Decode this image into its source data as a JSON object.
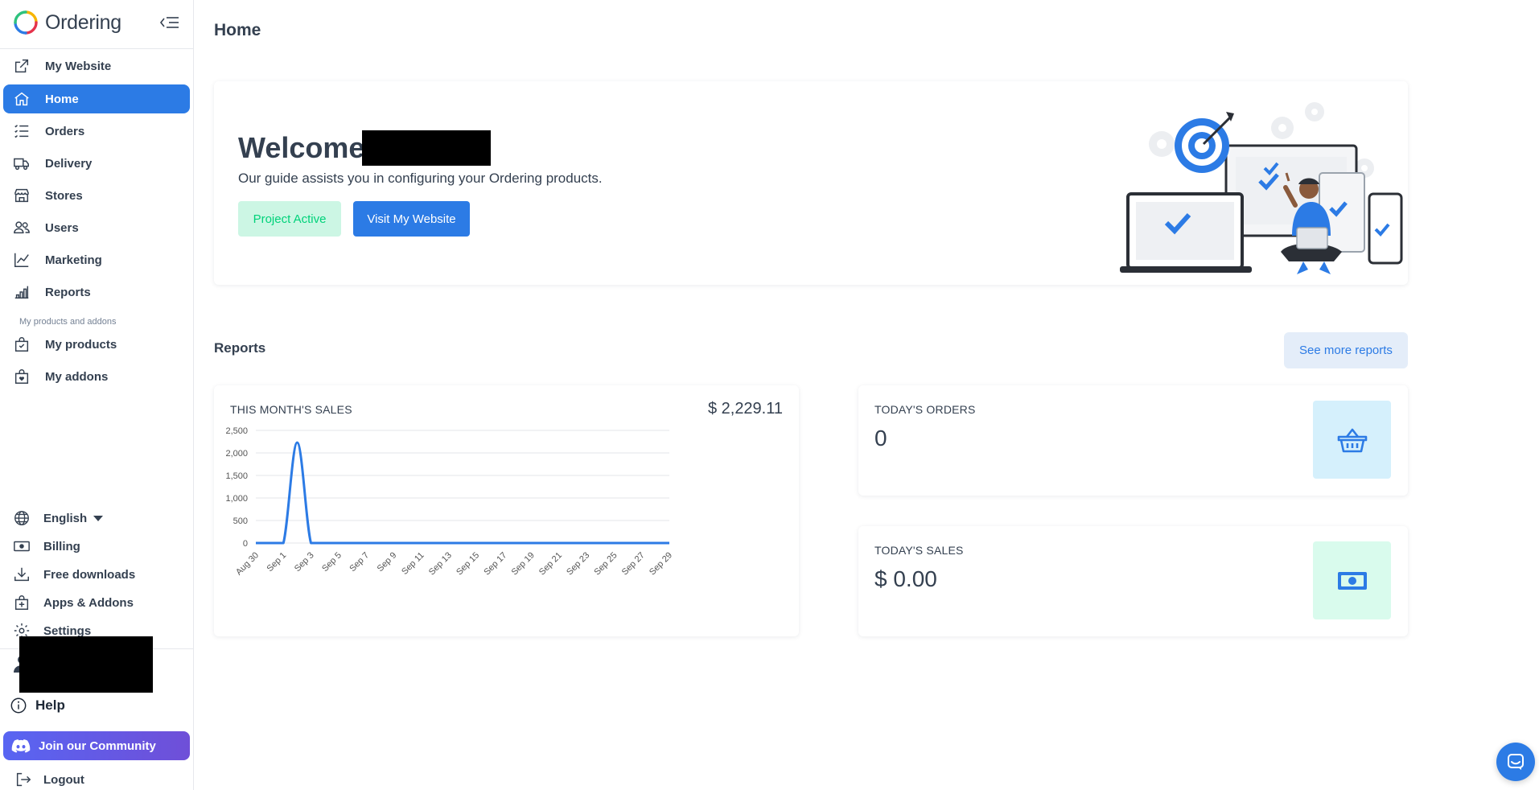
{
  "brand": {
    "name": "Ordering"
  },
  "sidebar": {
    "nav": [
      {
        "label": "My Website",
        "icon": "external-link-icon",
        "active": false
      },
      {
        "label": "Home",
        "icon": "house-icon",
        "active": true
      },
      {
        "label": "Orders",
        "icon": "list-icon",
        "active": false
      },
      {
        "label": "Delivery",
        "icon": "truck-icon",
        "active": false
      },
      {
        "label": "Stores",
        "icon": "shop-icon",
        "active": false
      },
      {
        "label": "Users",
        "icon": "people-icon",
        "active": false
      },
      {
        "label": "Marketing",
        "icon": "graph-up-icon",
        "active": false
      },
      {
        "label": "Reports",
        "icon": "bar-chart-icon",
        "active": false
      }
    ],
    "section_label": "My products and addons",
    "products": [
      {
        "label": "My products",
        "icon": "bag-check-icon"
      },
      {
        "label": "My addons",
        "icon": "bag-heart-icon"
      }
    ],
    "bottom": [
      {
        "label": "English",
        "icon": "globe-icon"
      },
      {
        "label": "Billing",
        "icon": "cash-icon"
      },
      {
        "label": "Free downloads",
        "icon": "download-icon"
      },
      {
        "label": "Apps & Addons",
        "icon": "bag-plus-icon"
      },
      {
        "label": "Settings",
        "icon": "gear-icon"
      }
    ],
    "help_label": "Help",
    "community_label": "Join our Community",
    "logout_label": "Logout"
  },
  "main": {
    "page_title": "Home",
    "welcome": {
      "title": "Welcome",
      "subtitle": "Our guide assists you in configuring your Ordering products.",
      "status_label": "Project Active",
      "visit_label": "Visit My Website"
    },
    "reports": {
      "title": "Reports",
      "see_more_label": "See more reports"
    },
    "sales_card": {
      "label": "THIS MONTH'S SALES",
      "total": "$ 2,229.11"
    },
    "orders_card": {
      "label": "TODAY'S ORDERS",
      "value": "0"
    },
    "today_sales_card": {
      "label": "TODAY'S SALES",
      "value": "$ 0.00"
    }
  },
  "colors": {
    "primary": "#2c7be5",
    "success_bg": "#ccf6e4",
    "success_text": "#00d27a",
    "info_bg": "#d5f0fc",
    "mint_bg": "#d9fbed",
    "discord": "#5865f2"
  },
  "chart_data": {
    "type": "line",
    "x": [
      "Aug 30",
      "Aug 31",
      "Sep 1",
      "Sep 2",
      "Sep 3",
      "Sep 4",
      "Sep 5",
      "Sep 6",
      "Sep 7",
      "Sep 8",
      "Sep 9",
      "Sep 10",
      "Sep 11",
      "Sep 12",
      "Sep 13",
      "Sep 14",
      "Sep 15",
      "Sep 16",
      "Sep 17",
      "Sep 18",
      "Sep 19",
      "Sep 20",
      "Sep 21",
      "Sep 22",
      "Sep 23",
      "Sep 24",
      "Sep 25",
      "Sep 26",
      "Sep 27",
      "Sep 28",
      "Sep 29"
    ],
    "x_ticks": [
      "Aug 30",
      "Sep 1",
      "Sep 3",
      "Sep 5",
      "Sep 7",
      "Sep 9",
      "Sep 11",
      "Sep 13",
      "Sep 15",
      "Sep 17",
      "Sep 19",
      "Sep 21",
      "Sep 23",
      "Sep 25",
      "Sep 27",
      "Sep 29"
    ],
    "values": [
      0,
      0,
      0,
      2229.11,
      0,
      0,
      0,
      0,
      0,
      0,
      0,
      0,
      0,
      0,
      0,
      0,
      0,
      0,
      0,
      0,
      0,
      0,
      0,
      0,
      0,
      0,
      0,
      0,
      0,
      0,
      0
    ],
    "y_ticks": [
      0,
      500,
      1000,
      1500,
      2000,
      2500
    ],
    "y_tick_labels": [
      "0",
      "500",
      "1,000",
      "1,500",
      "2,000",
      "2,500"
    ],
    "ylim": [
      0,
      2500
    ],
    "grid": true,
    "legend": "none"
  }
}
